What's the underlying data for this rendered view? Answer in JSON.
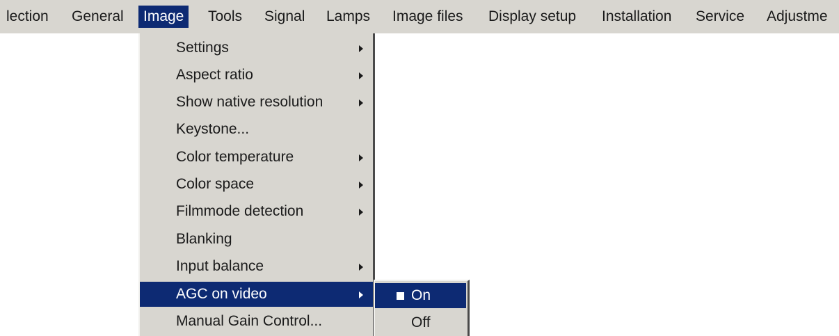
{
  "menubar": {
    "items": [
      {
        "label": "lection"
      },
      {
        "label": "General"
      },
      {
        "label": "Image"
      },
      {
        "label": "Tools"
      },
      {
        "label": "Signal"
      },
      {
        "label": "Lamps"
      },
      {
        "label": "Image files"
      },
      {
        "label": "Display setup"
      },
      {
        "label": "Installation"
      },
      {
        "label": "Service"
      },
      {
        "label": "Adjustme"
      }
    ],
    "active": "Image"
  },
  "image_menu": {
    "items": [
      {
        "label": "Settings",
        "submenu": true
      },
      {
        "label": "Aspect ratio",
        "submenu": true
      },
      {
        "label": "Show native resolution",
        "submenu": true
      },
      {
        "label": "Keystone...",
        "submenu": false
      },
      {
        "label": "Color temperature",
        "submenu": true
      },
      {
        "label": "Color space",
        "submenu": true
      },
      {
        "label": "Filmmode detection",
        "submenu": true
      },
      {
        "label": "Blanking",
        "submenu": false
      },
      {
        "label": "Input balance",
        "submenu": true
      },
      {
        "label": "AGC on video",
        "submenu": true
      },
      {
        "label": "Manual Gain Control...",
        "submenu": false
      }
    ],
    "active": "AGC on video"
  },
  "agc_submenu": {
    "items": [
      {
        "label": "On",
        "selected": true
      },
      {
        "label": "Off",
        "selected": false
      }
    ]
  },
  "colors": {
    "menu_bg": "#d8d6d0",
    "highlight": "#0d2a73",
    "text": "#1a1a1a",
    "highlight_text": "#ffffff"
  }
}
